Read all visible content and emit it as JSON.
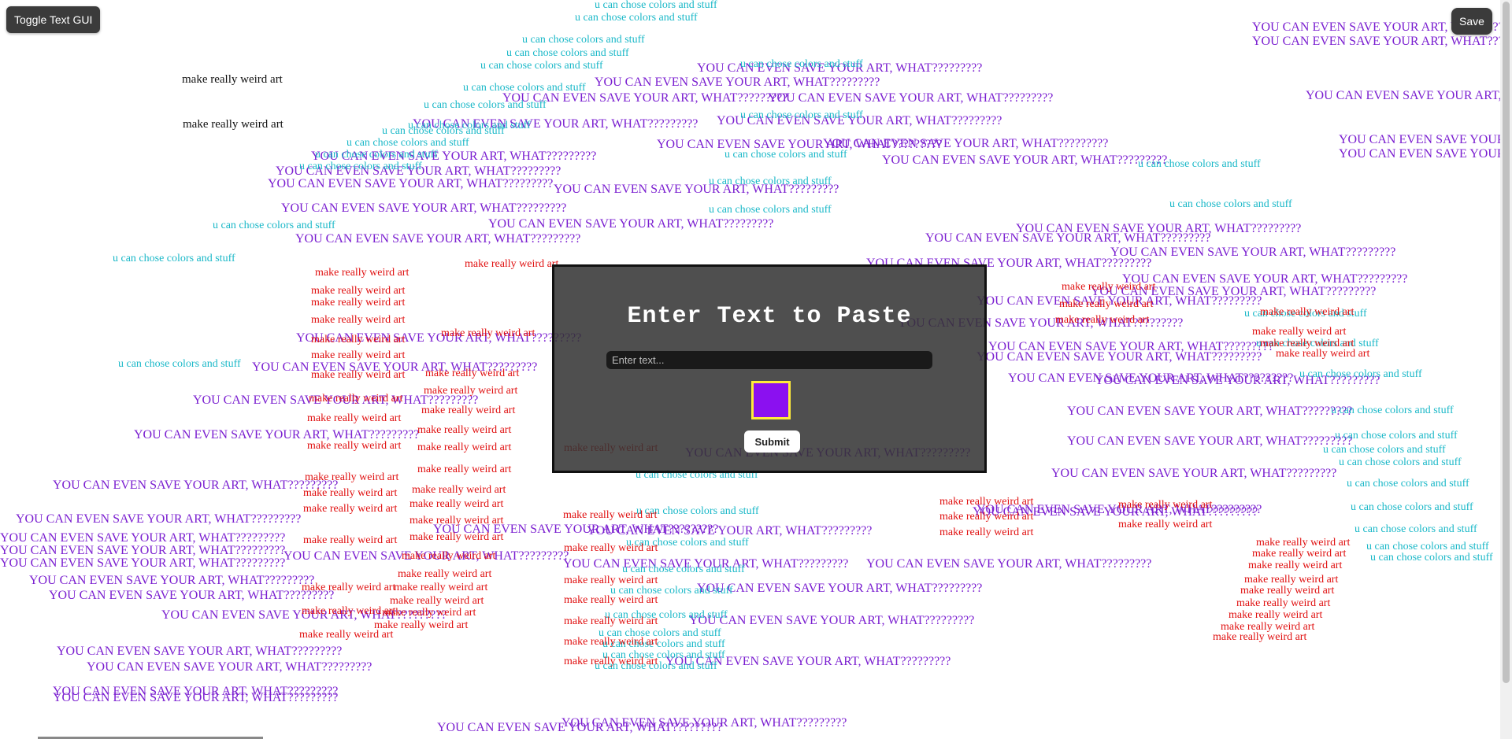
{
  "toolbar": {
    "toggle_label": "Toggle Text GUI",
    "save_label": "Save"
  },
  "modal": {
    "title": "Enter Text to Paste",
    "input_placeholder": "Enter text...",
    "input_value": "",
    "selected_color": "#8b10f0",
    "submit_label": "Submit"
  },
  "stamp_texts": {
    "black": "make really weird art",
    "red": "make really weird art",
    "cyan": "u can chose colors and stuff",
    "purple": "YOU CAN EVEN SAVE YOUR ART, WHAT?????????"
  },
  "colors": {
    "purple": "#7a1ed0",
    "red": "#e01010",
    "cyan": "#1ab8c8",
    "black": "#111111",
    "modal_bg": "#333333",
    "swatch_border": "#ffeb3b"
  }
}
